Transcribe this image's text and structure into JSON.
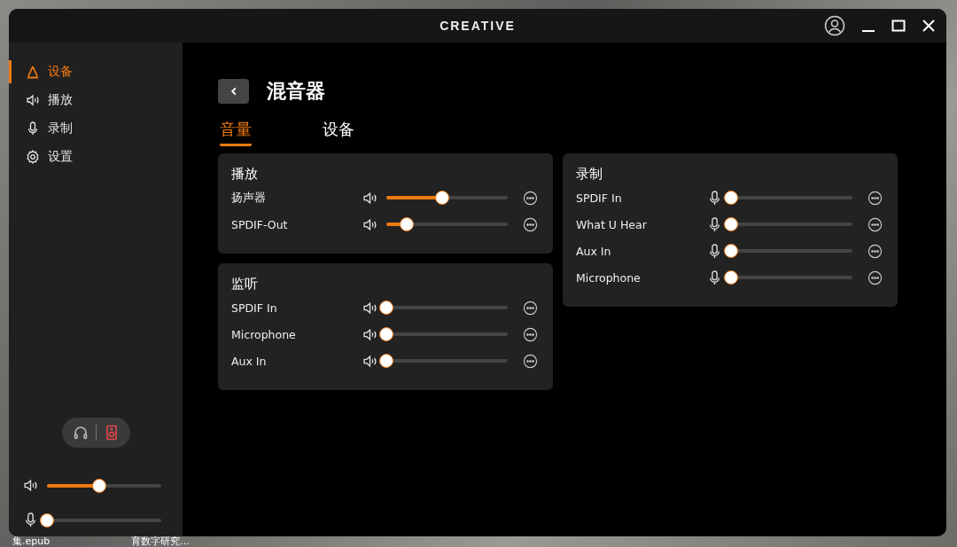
{
  "window": {
    "title": "CREATIVE"
  },
  "sidebar": {
    "items": [
      {
        "label": "设备",
        "selected": true
      },
      {
        "label": "播放",
        "selected": false
      },
      {
        "label": "录制",
        "selected": false
      },
      {
        "label": "设置",
        "selected": false
      }
    ],
    "output_toggle": [
      {
        "kind": "headphones",
        "selected": false
      },
      {
        "kind": "speaker",
        "selected": true
      }
    ],
    "sliders": [
      {
        "kind": "playback",
        "level": 0.46
      },
      {
        "kind": "recording",
        "level": 0
      }
    ]
  },
  "page": {
    "title": "混音器",
    "tabs": [
      {
        "label": "音量",
        "selected": true
      },
      {
        "label": "设备",
        "selected": false
      }
    ]
  },
  "mixer": {
    "columns": [
      {
        "panels": [
          {
            "title": "播放",
            "kind": "playback",
            "channels": [
              {
                "name": "扬声器",
                "level": 0.46
              },
              {
                "name": "SPDIF-Out",
                "level": 0.17
              }
            ]
          },
          {
            "title": "监听",
            "kind": "playback",
            "channels": [
              {
                "name": "SPDIF In",
                "level": 0
              },
              {
                "name": "Microphone",
                "level": 0
              },
              {
                "name": "Aux In",
                "level": 0
              }
            ]
          }
        ]
      },
      {
        "panels": [
          {
            "title": "录制",
            "kind": "recording",
            "channels": [
              {
                "name": "SPDIF In",
                "level": 0
              },
              {
                "name": "What U Hear",
                "level": 0
              },
              {
                "name": "Aux In",
                "level": 0
              },
              {
                "name": "Microphone",
                "level": 0
              }
            ]
          }
        ]
      }
    ]
  },
  "desktop": {
    "labels": [
      "集.epub",
      "育数字研究..."
    ]
  }
}
